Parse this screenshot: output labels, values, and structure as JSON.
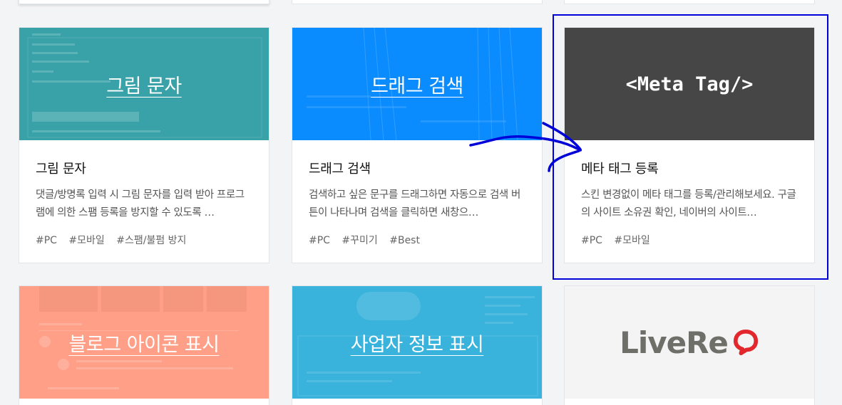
{
  "colors": {
    "background": "#f3f4f6",
    "teal": "#38a2a8",
    "blue": "#0a8cff",
    "dark": "#464646",
    "salmon": "#ff9f87",
    "sky": "#3ab3dc",
    "livere_bg": "#f4f4f5",
    "livere_red": "#e3282d",
    "annotation": "#0000d8"
  },
  "cards_row1": [
    {
      "thumb_title": "그림 문자",
      "title": "그림 문자",
      "desc": "댓글/방명록 입력 시 그림 문자를 입력 받아 프로그램에 의한 스팸 등록을 방지할 수 있도록 …",
      "tags": [
        "#PC",
        "#모바일",
        "#스팸/불펌 방지"
      ]
    },
    {
      "thumb_title": "드래그 검색",
      "title": "드래그 검색",
      "desc": "검색하고 싶은 문구를 드래그하면 자동으로 검색 버튼이 나타나며 검색을 클릭하면 새창으…",
      "tags": [
        "#PC",
        "#꾸미기",
        "#Best"
      ]
    },
    {
      "thumb_title": "<Meta Tag/>",
      "title": "메타 태그 등록",
      "desc": "스킨 변경없이 메타 태그를 등록/관리해보세요. 구글의 사이트 소유권 확인, 네이버의 사이트…",
      "tags": [
        "#PC",
        "#모바일"
      ]
    }
  ],
  "cards_row2": [
    {
      "thumb_title": "블로그 아이콘 표시",
      "icon": "blog-icon-thumbnail"
    },
    {
      "thumb_title": "사업자 정보 표시",
      "icon": "business-info-thumbnail"
    },
    {
      "logo_text": "LiveRe",
      "icon": "livere-logo"
    }
  ]
}
